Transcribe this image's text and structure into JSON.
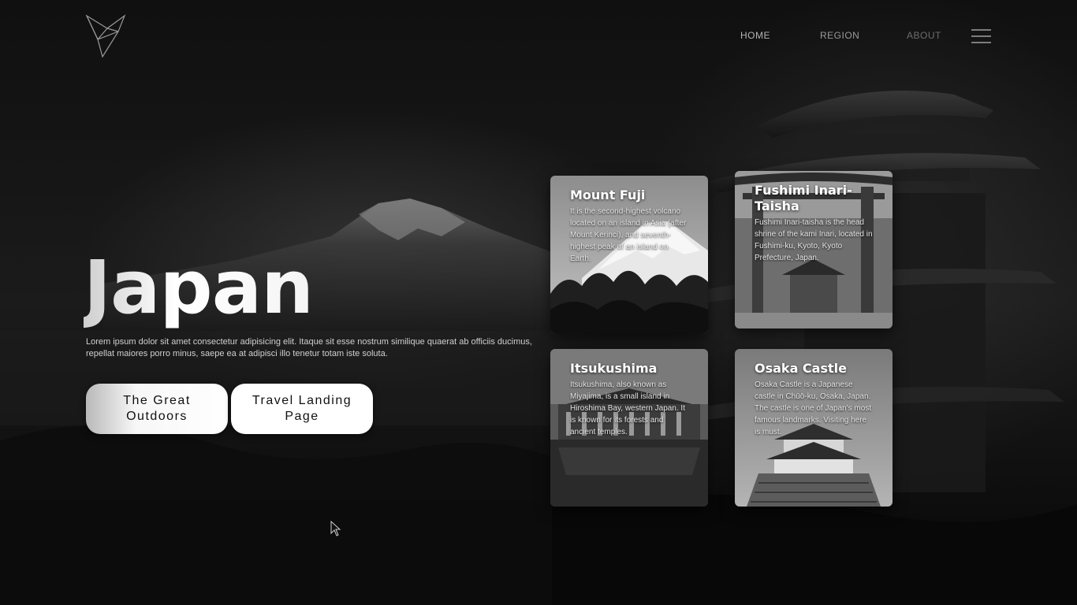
{
  "nav": {
    "home": "HOME",
    "region": "REGION",
    "about": "ABOUT"
  },
  "hero": {
    "title": "Japan",
    "description": "Lorem ipsum dolor sit amet consectetur adipisicing elit. Itaque sit esse nostrum similique quaerat ab officiis ducimus, repellat maiores porro minus, saepe ea at adipisci illo tenetur totam iste soluta.",
    "buttons": [
      {
        "label": "The Great Outdoors"
      },
      {
        "label": "Travel Landing Page"
      }
    ]
  },
  "cards": [
    {
      "title": "Mount Fuji",
      "text": "It is the second-highest volcano located on an island in Asia (after Mount Kerinci), and seventh-highest peak of an island on Earth."
    },
    {
      "title": "Fushimi Inari-Taisha",
      "text": "Fushimi Inari-taisha is the head shrine of the kami Inari, located in Fushimi-ku, Kyoto, Kyoto Prefecture, Japan."
    },
    {
      "title": "Itsukushima",
      "text": "Itsukushima, also known as Miyajima, is a small island in Hiroshima Bay, western Japan. It is known for its forests and ancient temples."
    },
    {
      "title": "Osaka Castle",
      "text": "Osaka Castle is a Japanese castle in Chūō-ku, Osaka, Japan. The castle is one of Japan's most famous landmarks. Visiting here is must."
    }
  ],
  "icons": {
    "logo": "origami-bird-icon",
    "menu": "hamburger-menu-icon",
    "cursor": "mouse-cursor-icon"
  },
  "theme": {
    "background": "#0b0b0b",
    "button_bg": "#ffffff",
    "text": "#eaeaea"
  }
}
